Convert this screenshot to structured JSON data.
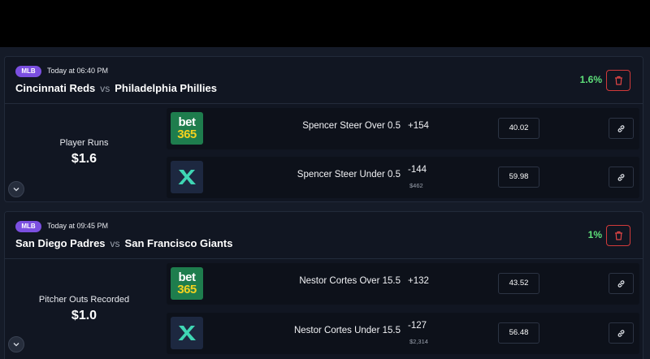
{
  "games": [
    {
      "league": "MLB",
      "time": "Today at 06:40 PM",
      "home_team": "Cincinnati Reds",
      "vs": "vs",
      "away_team": "Philadelphia Phillies",
      "percent": "1.6%",
      "market": "Player Runs",
      "amount": "$1.6",
      "bets": [
        {
          "book": "bet365",
          "book_line1": "bet",
          "book_line2": "365",
          "selection": "Spencer Steer Over 0.5",
          "odds": "+154",
          "sub": "",
          "value": "40.02"
        },
        {
          "book": "x-sportsbook",
          "selection": "Spencer Steer Under 0.5",
          "odds": "-144",
          "sub": "$462",
          "value": "59.98"
        }
      ]
    },
    {
      "league": "MLB",
      "time": "Today at 09:45 PM",
      "home_team": "San Diego Padres",
      "vs": "vs",
      "away_team": "San Francisco Giants",
      "percent": "1%",
      "market": "Pitcher Outs Recorded",
      "amount": "$1.0",
      "bets": [
        {
          "book": "bet365",
          "book_line1": "bet",
          "book_line2": "365",
          "selection": "Nestor Cortes Over 15.5",
          "odds": "+132",
          "sub": "",
          "value": "43.52"
        },
        {
          "book": "x-sportsbook",
          "selection": "Nestor Cortes Under 15.5",
          "odds": "-127",
          "sub": "$2,314",
          "value": "56.48"
        }
      ]
    }
  ],
  "colors": {
    "accent_green": "#5ee07a",
    "danger": "#d23a3a",
    "badge": "#7b4fe0",
    "bet365_green": "#1e7d4d",
    "bet365_yellow": "#f3d21f",
    "x_teal": "#3fd6b4"
  },
  "icons": {
    "delete": "trash-icon",
    "expand": "chevron-down-icon",
    "link": "link-icon",
    "x_logo": "x-logo-icon"
  }
}
